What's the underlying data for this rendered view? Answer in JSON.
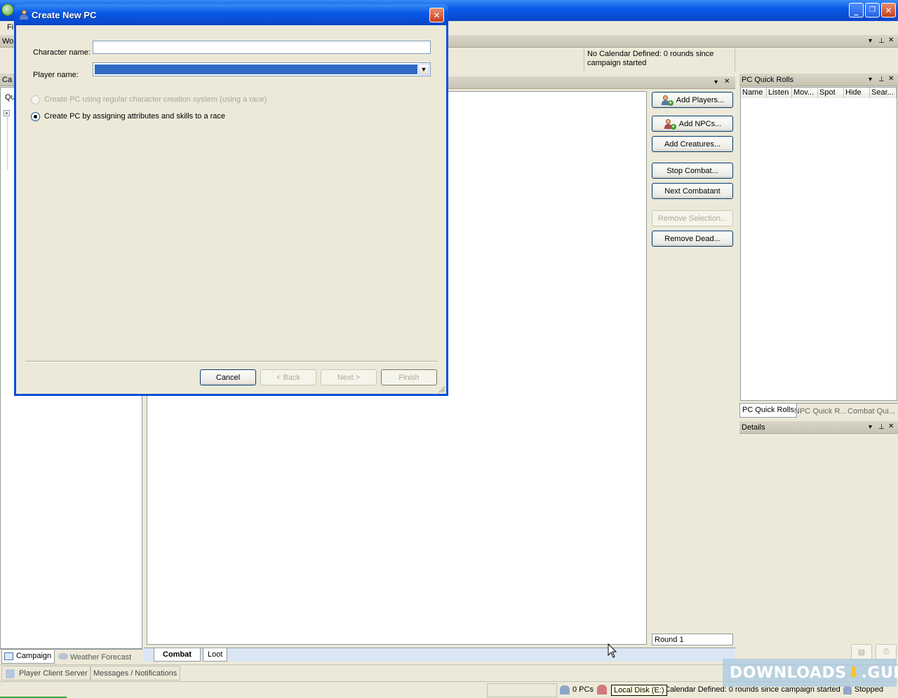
{
  "main_window": {
    "menu_first": "Fi",
    "win_controls": {
      "minimize": "_",
      "restore": "❐",
      "close": "✕"
    }
  },
  "left_panel": {
    "header_top": "Wo",
    "header_campaign": "Ca",
    "quick": "Qu",
    "tabs": [
      "Campaign",
      "Weather Forecast"
    ]
  },
  "calendar_text": "No Calendar Defined: 0 rounds since campaign started",
  "combat": {
    "buttons": {
      "add_players": "Add Players...",
      "add_npcs": "Add NPCs...",
      "add_creatures": "Add Creatures...",
      "stop_combat": "Stop Combat...",
      "next_combatant": "Next Combatant",
      "remove_selection": "Remove Selection...",
      "remove_dead": "Remove Dead..."
    },
    "round": "Round 1",
    "tabs": [
      "Combat",
      "Loot"
    ]
  },
  "pc_quick_rolls": {
    "title": "PC Quick Rolls",
    "columns": [
      "Name",
      "Listen",
      "Mov...",
      "Spot",
      "Hide",
      "Sear..."
    ],
    "tabs": [
      "PC Quick Rolls",
      "NPC Quick R...",
      "Combat Qui..."
    ]
  },
  "details": {
    "title": "Details"
  },
  "bottom_tabs": [
    "Player Client Server",
    "Messages / Notifications"
  ],
  "status_bar": {
    "pcs": "0 PCs",
    "calendar": "Calendar Defined: 0 rounds since campaign started",
    "tooltip": "Local Disk (E:)",
    "state": "Stopped"
  },
  "dialog": {
    "title": "Create New PC",
    "character_name_label": "Character name:",
    "character_name_value": "",
    "player_name_label": "Player name:",
    "player_name_value": "",
    "radio_race": "Create PC using regular character creation system (using a race)",
    "radio_assign": "Create PC by assigning attributes and skills to a race",
    "buttons": {
      "cancel": "Cancel",
      "back": "< Back",
      "next": "Next >",
      "finish": "Finish"
    }
  },
  "watermark": "DOWNLOADS",
  "watermark_suffix": ".GURU",
  "colors": {
    "xp_blue": "#0a5ae8",
    "selection_blue": "#316ac5",
    "panel_bg": "#ece9d8"
  }
}
